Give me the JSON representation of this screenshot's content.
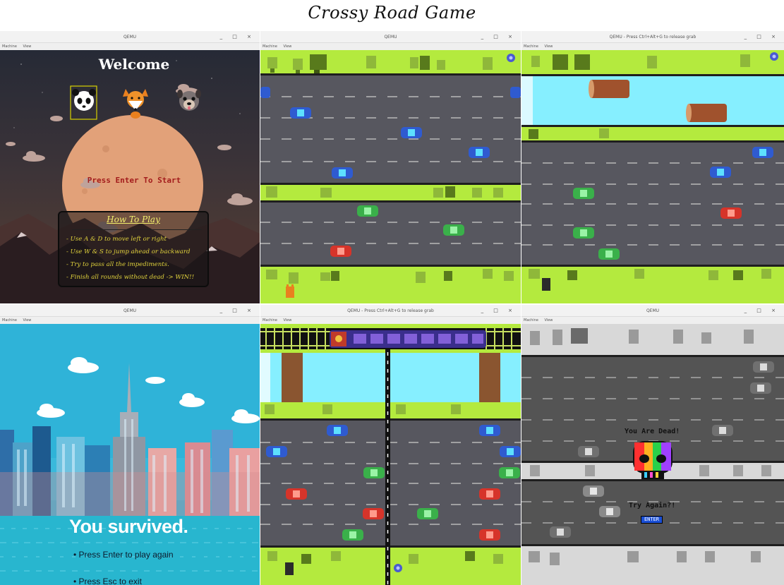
{
  "page_title": "Crossy Road Game",
  "windows": {
    "w1": {
      "title": "QEMU",
      "menu": [
        "Machine",
        "View"
      ]
    },
    "w2": {
      "title": "QEMU",
      "menu": [
        "Machine",
        "View"
      ]
    },
    "w3": {
      "title": "QEMU - Press Ctrl+Alt+G to release grab",
      "menu": [
        "Machine",
        "View"
      ]
    },
    "w4": {
      "title": "QEMU",
      "menu": [
        "Machine",
        "View"
      ]
    },
    "w5": {
      "title": "QEMU - Press Ctrl+Alt+G to release grab",
      "menu": [
        "Machine",
        "View"
      ]
    },
    "w6": {
      "title": "QEMU",
      "menu": [
        "Machine",
        "View"
      ]
    }
  },
  "window_controls": "_ □ ×",
  "welcome": {
    "title": "Welcome",
    "press_start": "Press Enter To Start",
    "how_to_play_title": "How To Play",
    "how_to_play_items": [
      "- Use A & D to move left or right",
      "- Use W & S to jump ahead or backward",
      "- Try to pass all the impediments.",
      "- Finish all rounds without dead -> WIN!!"
    ],
    "characters": [
      "panda-icon",
      "fox-icon",
      "pug-icon"
    ]
  },
  "survived": {
    "message": "You survived.",
    "items": [
      "• Press Enter to play again",
      "• Press Esc to exit"
    ]
  },
  "dead": {
    "message": "You Are Dead!",
    "retry": "Try Again?!",
    "enter_button": "ENTER"
  },
  "colors": {
    "grass": "#b4ea3e",
    "road": "#57575f",
    "water": "#86efff",
    "tree_top": "#8fb83a",
    "tree_dark": "#587a1c",
    "log": "#a0522d",
    "accent_red": "#a31c1c",
    "accent_yellow": "#e0d23c"
  }
}
